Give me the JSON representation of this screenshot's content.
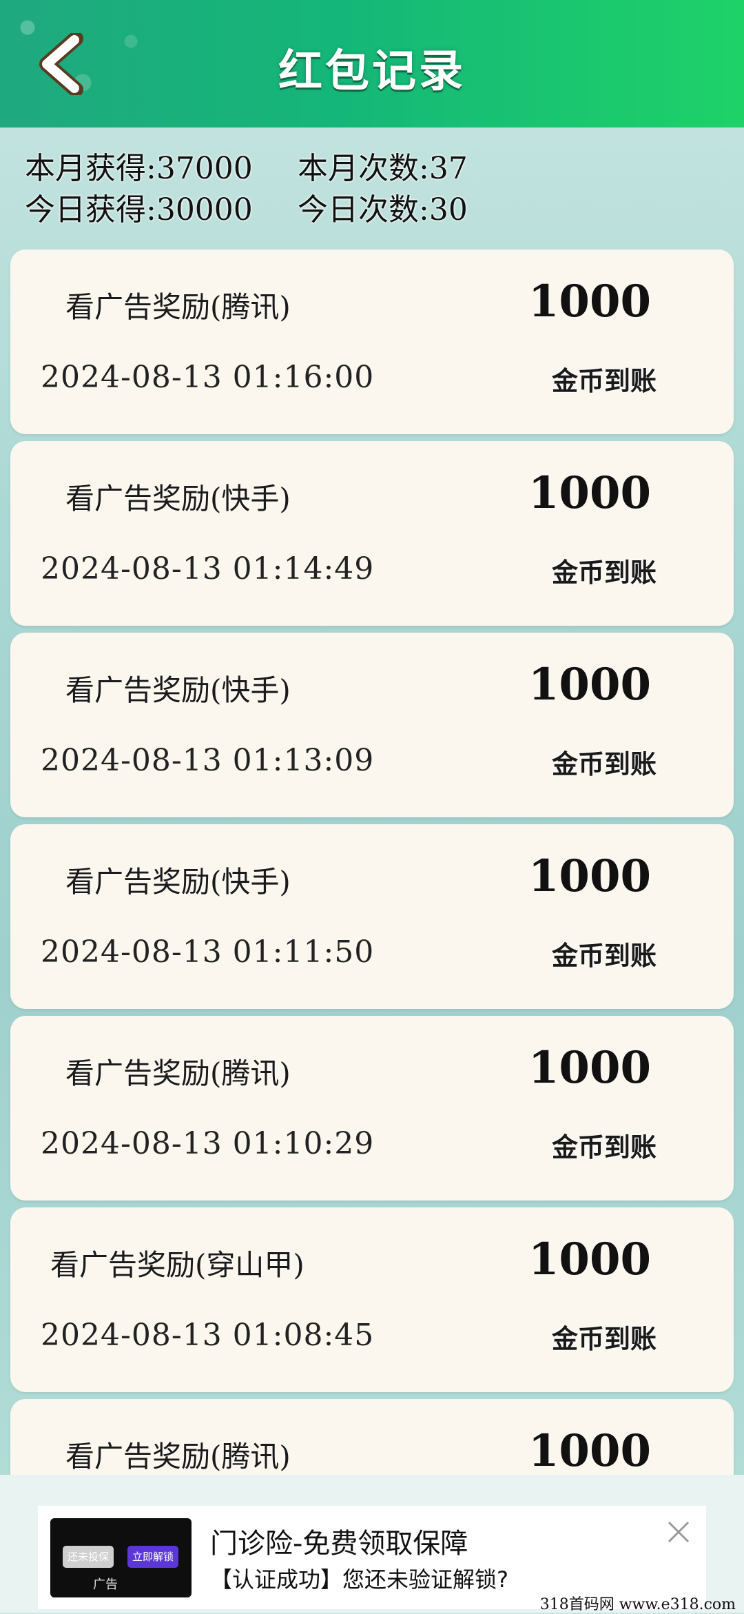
{
  "header": {
    "title": "红包记录",
    "back_icon": "chevron-left-icon"
  },
  "stats": {
    "month_earned": "本月获得:37000",
    "month_count": "本月次数:37",
    "today_earned": "今日获得:30000",
    "today_count": "今日次数:30"
  },
  "records": [
    {
      "name": "看广告奖励(腾讯)",
      "time": "2024-08-13 01:16:00",
      "amount": "1000",
      "status": "金币到账"
    },
    {
      "name": "看广告奖励(快手)",
      "time": "2024-08-13 01:14:49",
      "amount": "1000",
      "status": "金币到账"
    },
    {
      "name": "看广告奖励(快手)",
      "time": "2024-08-13 01:13:09",
      "amount": "1000",
      "status": "金币到账"
    },
    {
      "name": "看广告奖励(快手)",
      "time": "2024-08-13 01:11:50",
      "amount": "1000",
      "status": "金币到账"
    },
    {
      "name": "看广告奖励(腾讯)",
      "time": "2024-08-13 01:10:29",
      "amount": "1000",
      "status": "金币到账"
    },
    {
      "name": "看广告奖励(穿山甲)",
      "time": "2024-08-13 01:08:45",
      "amount": "1000",
      "status": "金币到账"
    },
    {
      "name": "看广告奖励(腾讯)",
      "time": "",
      "amount": "1000",
      "status": ""
    }
  ],
  "ad": {
    "title": "门诊险-免费领取保障",
    "subtitle": "【认证成功】您还未验证解锁?",
    "thumb_btn_left": "还未投保",
    "thumb_btn_right": "立即解锁",
    "thumb_tag": "广告",
    "close_icon": "close-icon"
  },
  "watermark": "318首码网  www.e318.com",
  "colors": {
    "header_start": "#1fa97e",
    "header_end": "#1ed268",
    "card_bg": "#fbf7ee",
    "page_bg": "#a9d7d3"
  }
}
